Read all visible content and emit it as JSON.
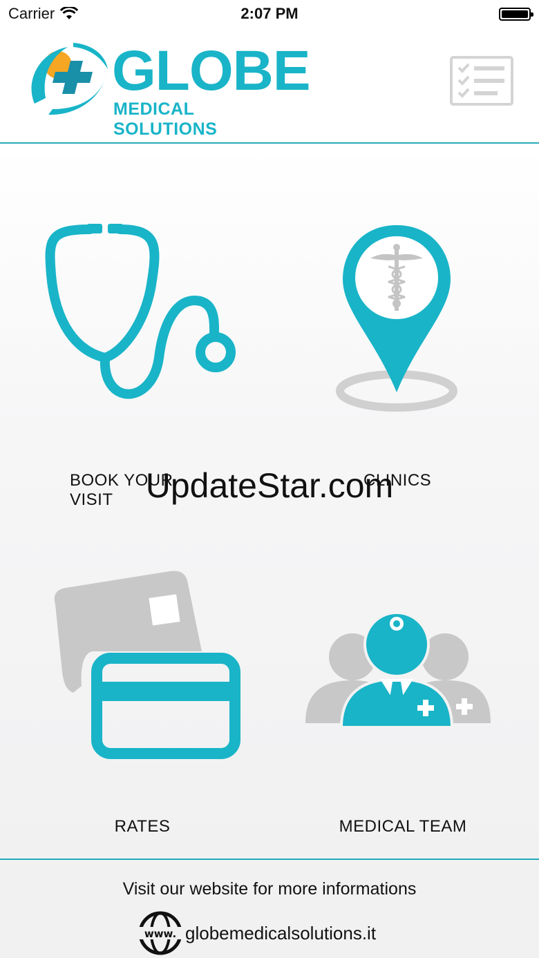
{
  "status_bar": {
    "carrier": "Carrier",
    "time": "2:07 PM",
    "wifi_icon": "wifi-icon",
    "battery_icon": "battery-icon"
  },
  "header": {
    "logo_title": "GLOBE",
    "logo_subtitle": "MEDICAL SOLUTIONS",
    "menu_icon": "checklist-icon"
  },
  "tiles": [
    {
      "label": "BOOK YOUR VISIT",
      "icon": "stethoscope-icon"
    },
    {
      "label": "CLINICS",
      "icon": "map-pin-caduceus-icon"
    },
    {
      "label": "RATES",
      "icon": "credit-card-icon"
    },
    {
      "label": "MEDICAL TEAM",
      "icon": "medical-team-icon"
    }
  ],
  "watermark": "UpdateStar.com",
  "footer": {
    "text": "Visit our website for more informations",
    "url": "globemedicalsolutions.it",
    "www_icon": "www-globe-icon"
  },
  "colors": {
    "accent": "#19b4c8",
    "icon_gray": "#c8c8c8",
    "divider": "#23aab9",
    "logo_orange": "#f5a623"
  }
}
